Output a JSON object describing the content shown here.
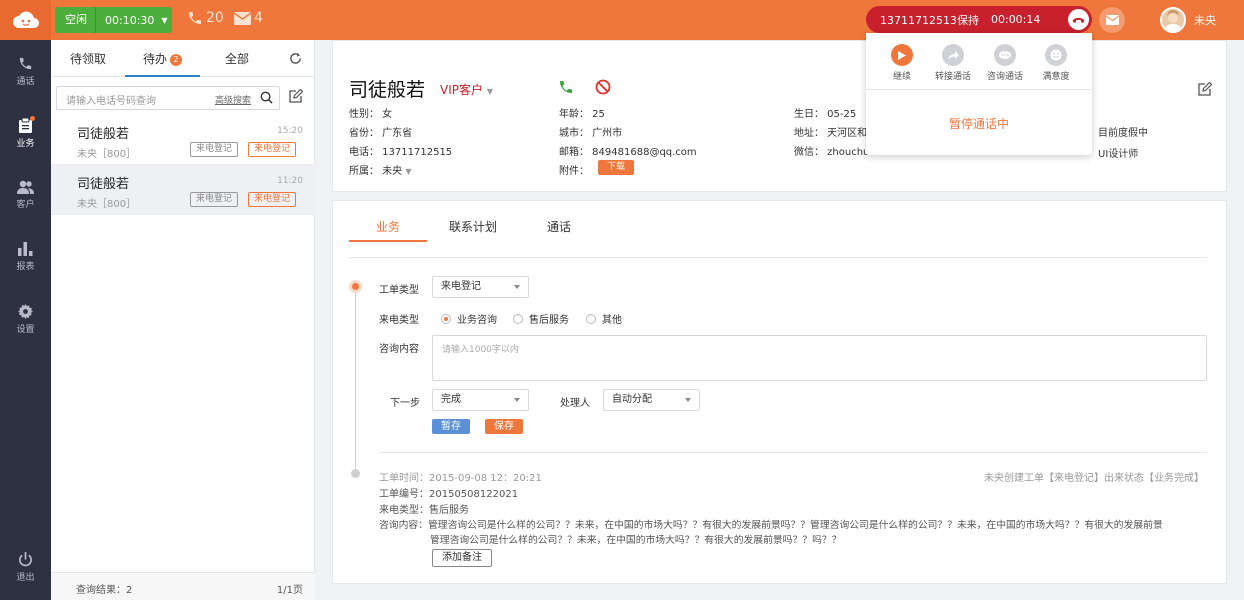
{
  "topbar": {
    "status_label": "空闲",
    "status_timer": "00:10:30",
    "missed_calls": "20",
    "messages": "4",
    "call": {
      "number_status": "13711712513保持",
      "timer": "00:00:14"
    },
    "user_name": "未央"
  },
  "call_popup": {
    "actions": [
      {
        "label": "继续",
        "icon": "play-icon"
      },
      {
        "label": "转接通话",
        "icon": "transfer-icon"
      },
      {
        "label": "咨询通话",
        "icon": "consult-icon"
      },
      {
        "label": "满意度",
        "icon": "smile-icon"
      }
    ],
    "status": "暂停通话中"
  },
  "sidenav": {
    "items": [
      {
        "label": "通话",
        "icon": "phone-icon"
      },
      {
        "label": "业务",
        "icon": "clipboard-icon"
      },
      {
        "label": "客户",
        "icon": "users-icon"
      },
      {
        "label": "报表",
        "icon": "bar-chart-icon"
      },
      {
        "label": "设置",
        "icon": "gear-icon"
      },
      {
        "label": "退出",
        "icon": "power-icon"
      }
    ]
  },
  "left": {
    "tabs": [
      {
        "label": "待领取"
      },
      {
        "label": "待办",
        "badge": "2"
      },
      {
        "label": "全部"
      }
    ],
    "search": {
      "placeholder": "请输入电话号码查询",
      "advanced": "高级搜索"
    },
    "items": [
      {
        "name": "司徒般若",
        "time": "15:20",
        "sub": "未央［800］",
        "tag1": "来电登记",
        "tag2": "来电登记"
      },
      {
        "name": "司徒般若",
        "time": "11:20",
        "sub": "未央［800］",
        "tag1": "来电登记",
        "tag2": "来电登记"
      }
    ],
    "footer": {
      "result": "查询结果：2",
      "page": "1/1页"
    }
  },
  "customer": {
    "name": "司徒般若",
    "level": "VIP客户",
    "gender": "性别：  女",
    "province": "省份：  广东省",
    "phone": "电话：  13711712515",
    "owner": "所属：  未央",
    "age": "年龄：  25",
    "city": "城市：  广州市",
    "email": "邮箱：  849481688@qq.com",
    "attachment": "附件：",
    "download": "下载",
    "birthday": "生日：  05-25",
    "address": "地址：  天河区和",
    "wechat": "微信：  zhouchu",
    "note": "目前度假中",
    "job": "UI设计师"
  },
  "business": {
    "tabs": [
      "业务",
      "联系计划",
      "通话"
    ],
    "form": {
      "type_label": "工单类型",
      "type_value": "来电登记",
      "call_type_label": "来电类型",
      "radios": [
        "业务咨询",
        "售后服务",
        "其他"
      ],
      "content_label": "咨询内容",
      "content_placeholder": "请输入1000字以内",
      "next_label": "下一步",
      "next_value": "完成",
      "handler_label": "处理人",
      "handler_value": "自动分配",
      "temp_save": "暂存",
      "save": "保存"
    },
    "log": {
      "time": "工单时间：2015-09-08  12：20:21",
      "status": "未央创建工单【来电登记】出来状态【业务完成】",
      "number": "工单编号：20150508122021",
      "call_type": "来电类型：售后服务",
      "content1": "咨询内容：管理咨询公司是什么样的公司？？未来，在中国的市场大吗？？有很大的发展前景吗？？管理咨询公司是什么样的公司？？未来，在中国的市场大吗？？有很大的发展前景",
      "content2": "管理咨询公司是什么样的公司？？未来，在中国的市场大吗？？有很大的发展前景吗？？吗？？",
      "add_note": "添加备注"
    }
  },
  "colors": {
    "accent": "#f0773c",
    "nav": "#2e3142",
    "green": "#4caf3c",
    "call_red": "#c8202c",
    "blue": "#5b8fd6"
  }
}
